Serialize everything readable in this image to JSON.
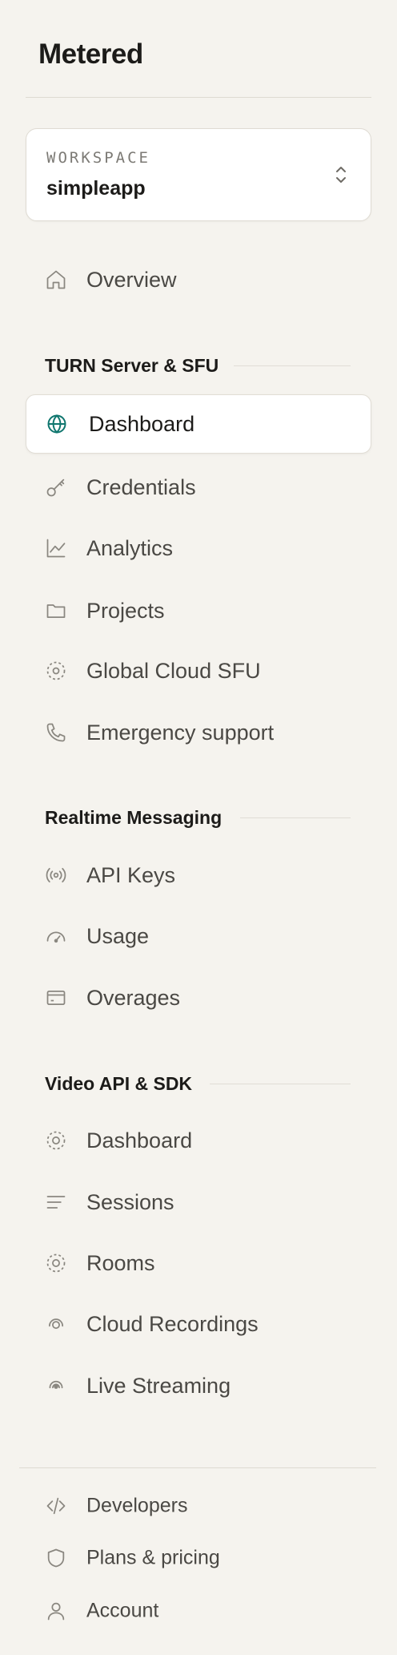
{
  "brand": {
    "name": "Metered"
  },
  "workspace": {
    "label": "WORKSPACE",
    "name": "simpleapp"
  },
  "nav": {
    "overview": "Overview",
    "turn": {
      "heading": "TURN Server & SFU",
      "items": [
        "Dashboard",
        "Credentials",
        "Analytics",
        "Projects",
        "Global Cloud SFU",
        "Emergency support"
      ],
      "active": "Dashboard"
    },
    "messaging": {
      "heading": "Realtime Messaging",
      "items": [
        "API Keys",
        "Usage",
        "Overages"
      ]
    },
    "video": {
      "heading": "Video API & SDK",
      "items": [
        "Dashboard",
        "Sessions",
        "Rooms",
        "Cloud Recordings",
        "Live Streaming"
      ]
    }
  },
  "footer": {
    "items": [
      "Developers",
      "Plans & pricing",
      "Account"
    ]
  },
  "colors": {
    "background": "#f5f3ee",
    "accent": "#0f766e",
    "icon": "#8a8780",
    "text": "#4a4844"
  }
}
